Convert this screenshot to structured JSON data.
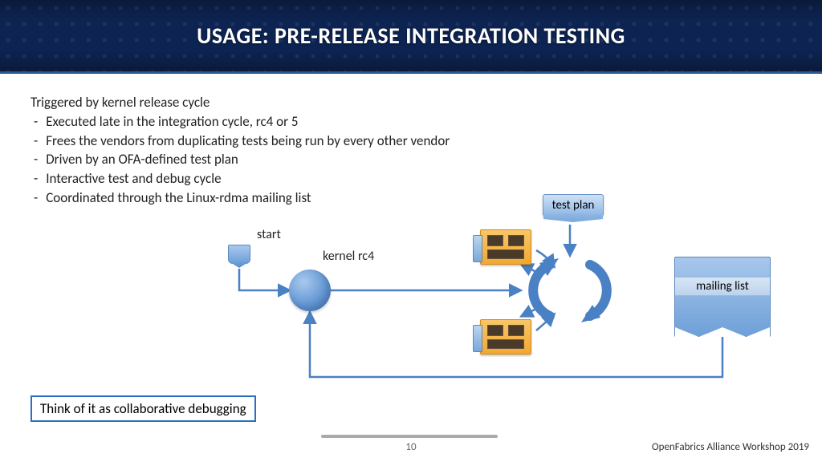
{
  "header": {
    "title": "USAGE: PRE-RELEASE INTEGRATION TESTING"
  },
  "content": {
    "lead": "Triggered by kernel release cycle",
    "bullets": [
      "Executed late in the integration cycle, rc4 or 5",
      "Frees the vendors from duplicating tests being run by every other vendor",
      "Driven by an OFA-defined test plan",
      "Interactive test and debug cycle",
      "Coordinated through the Linux-rdma mailing list"
    ],
    "callout": "Think of it as collaborative debugging"
  },
  "diagram": {
    "start_label": "start",
    "kernel_label": "kernel rc4",
    "testplan_label": "test plan",
    "mailing_label": "mailing list"
  },
  "footer": {
    "page": "10",
    "org": "OpenFabrics Alliance Workshop 2019"
  }
}
